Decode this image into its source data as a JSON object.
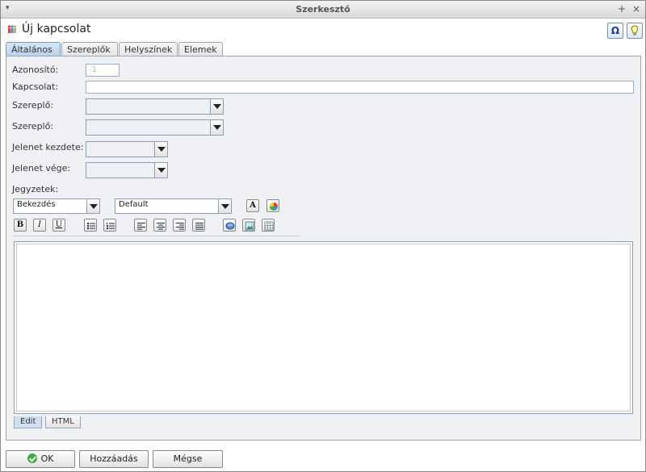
{
  "window": {
    "title": "Szerkesztő",
    "controls": {
      "menu": "▾",
      "maximize": "+",
      "close": "×"
    }
  },
  "header": {
    "title": "Új kapcsolat",
    "special_char_btn": "Ω",
    "hint_btn": "💡"
  },
  "tabs": [
    {
      "label": "Általános",
      "active": true
    },
    {
      "label": "Szereplők"
    },
    {
      "label": "Helyszínek"
    },
    {
      "label": "Elemek"
    }
  ],
  "form": {
    "id_label": "Azonosító:",
    "id_value": "-1",
    "relation_label": "Kapcsolat:",
    "relation_value": "",
    "actor1_label": "Szereplő:",
    "actor1_value": "",
    "actor2_label": "Szereplő:",
    "actor2_value": "",
    "scene_start_label": "Jelenet kezdete:",
    "scene_start_value": "",
    "scene_end_label": "Jelenet vége:",
    "scene_end_value": "",
    "notes_label": "Jegyzetek:"
  },
  "editor": {
    "paragraph_style": "Bekezdés",
    "font": "Default",
    "bold": "B",
    "italic": "I",
    "underline": "U",
    "font_btn": "A",
    "modes": [
      {
        "label": "Edit",
        "active": true
      },
      {
        "label": "HTML"
      }
    ]
  },
  "footer": {
    "ok": "OK",
    "add": "Hozzáadás",
    "cancel": "Mégse"
  }
}
